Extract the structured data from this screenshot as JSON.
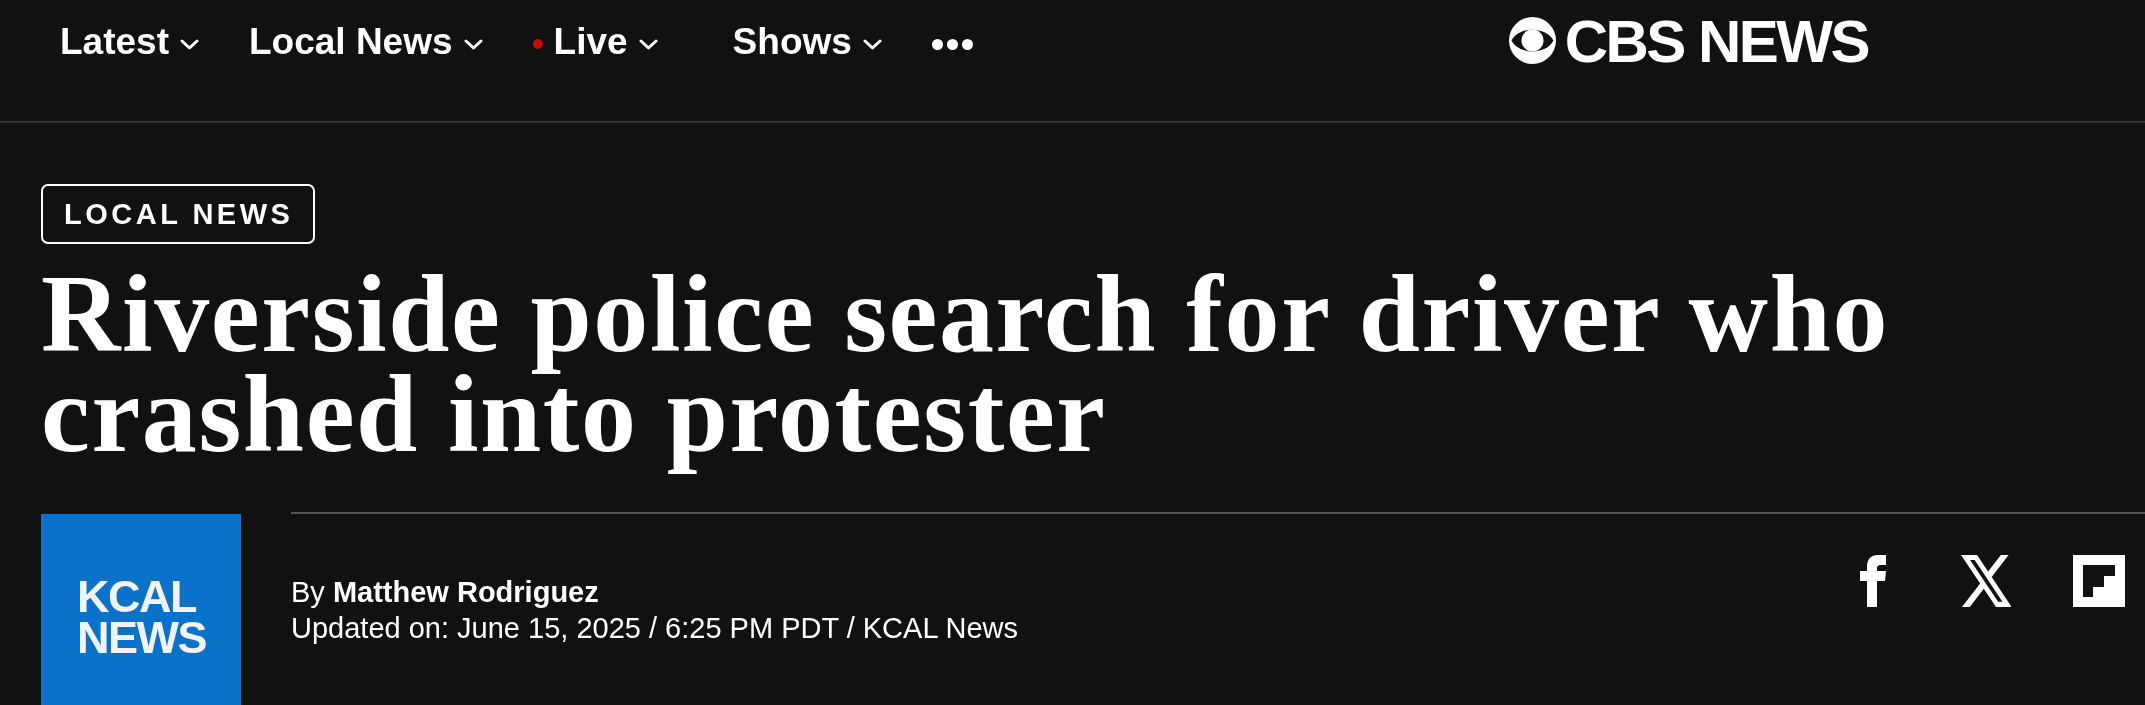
{
  "nav": {
    "items": [
      {
        "label": "Latest",
        "live": false
      },
      {
        "label": "Local News",
        "live": false
      },
      {
        "label": "Live",
        "live": true
      },
      {
        "label": "Shows",
        "live": false
      }
    ]
  },
  "brand": {
    "name": "CBS NEWS"
  },
  "article": {
    "category": "LOCAL NEWS",
    "headline": "Riverside police search for driver who crashed into protester",
    "source_logo": "KCAL NEWS",
    "byline": "By **Matthew Rodriguez**",
    "updated": "Updated on: June 15, 2025 / 6:25 PM PDT / KCAL News"
  }
}
